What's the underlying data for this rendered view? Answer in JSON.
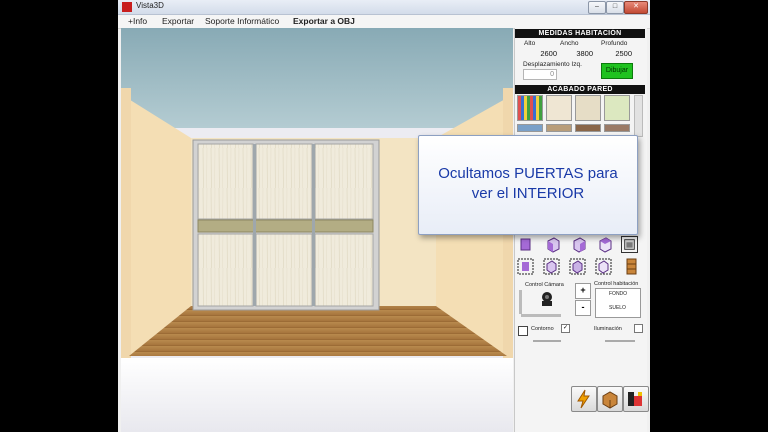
{
  "window": {
    "title": "Vista3D"
  },
  "menu": {
    "items": [
      "+Info",
      "Exportar",
      "Soporte Informático",
      "Exportar a OBJ"
    ]
  },
  "room": {
    "header": "MEDIDAS HABITACIÓN",
    "alto_label": "Alto",
    "alto_value": "2600",
    "ancho_label": "Ancho",
    "ancho_value": "3800",
    "profundo_label": "Profundo",
    "profundo_value": "2500",
    "desplazamiento_label": "Desplazamiento Izq.",
    "desplazamiento_value": "0",
    "dibujar_label": "Dibujar"
  },
  "finish": {
    "header": "ACABADO PARED"
  },
  "callout": {
    "line1": "Ocultamos PUERTAS para",
    "line2": "ver el INTERIOR"
  },
  "controls": {
    "camera_label": "Control Cámara",
    "room_label": "Control habitación",
    "fondo_label": "FONDO",
    "suelo_label": "SUELO",
    "plus": "+",
    "minus": "-",
    "contorno_label": "Contorno",
    "iluminacion_label": "Iluminación"
  },
  "colors": {
    "green_button": "#1fc21f",
    "callout_text": "#1a3aa8",
    "header_bg": "#111111"
  }
}
